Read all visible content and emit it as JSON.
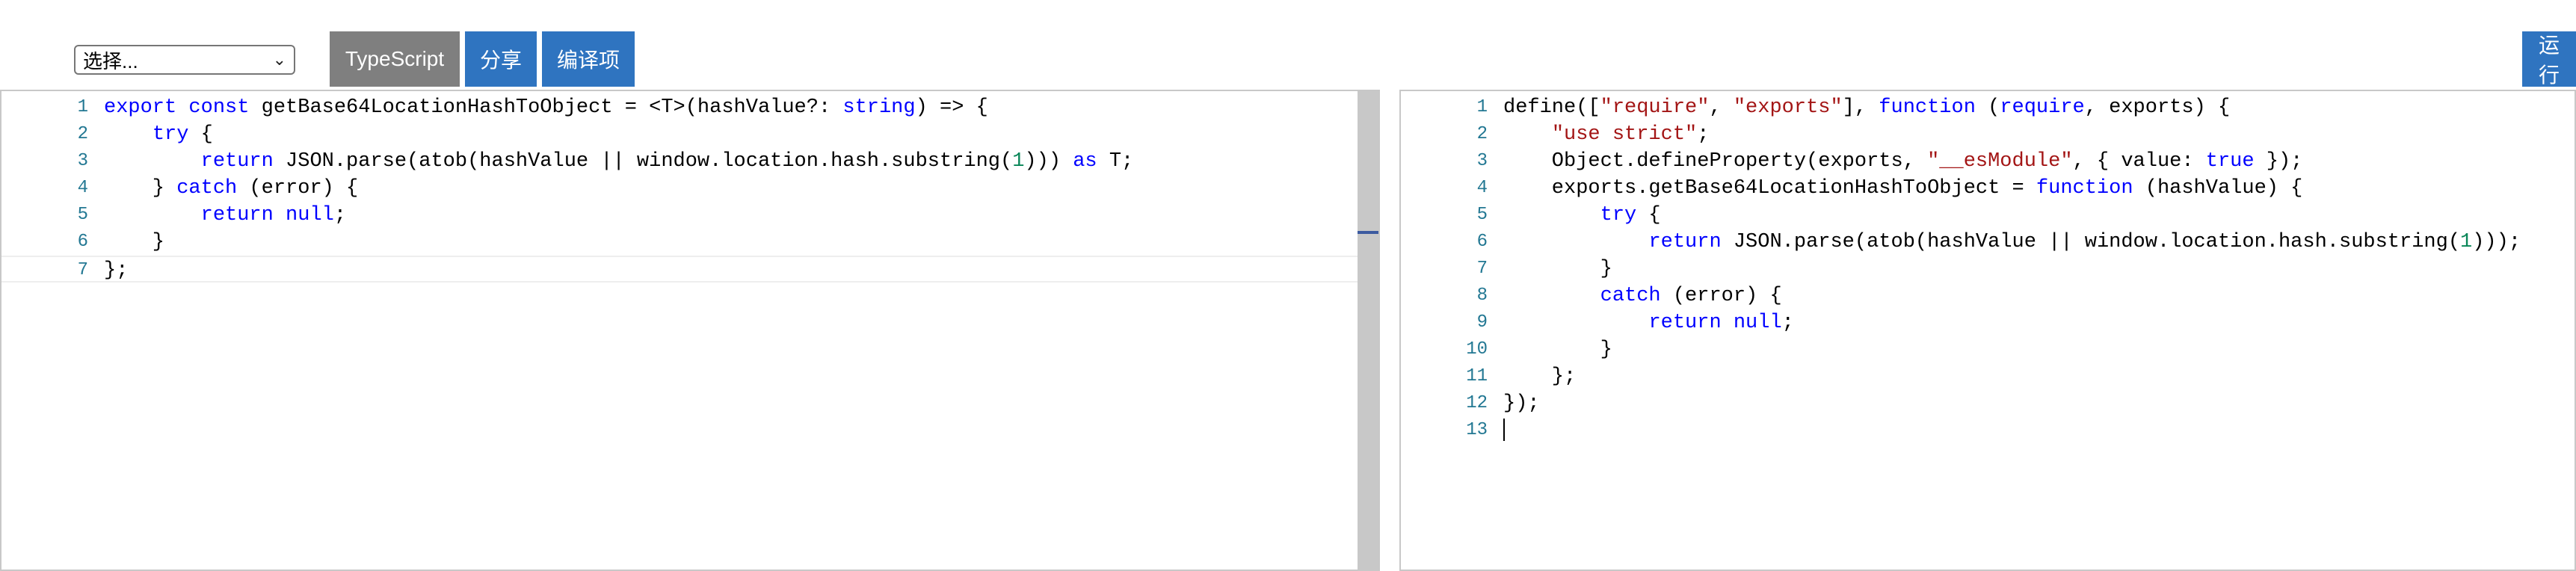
{
  "toolbar": {
    "select_value": "选择...",
    "lang_label": "TypeScript",
    "share_label": "分享",
    "options_label": "编译项",
    "run_label": "运行"
  },
  "left_editor": {
    "lines": [
      {
        "n": "1",
        "tokens": [
          {
            "t": "export",
            "c": "kw"
          },
          {
            "t": " ",
            "c": "id"
          },
          {
            "t": "const",
            "c": "kw"
          },
          {
            "t": " getBase64LocationHashToObject = <T>(hashValue?: ",
            "c": "id"
          },
          {
            "t": "string",
            "c": "kw"
          },
          {
            "t": ") => {",
            "c": "id"
          }
        ]
      },
      {
        "n": "2",
        "tokens": [
          {
            "t": "    ",
            "c": "id"
          },
          {
            "t": "try",
            "c": "kw"
          },
          {
            "t": " {",
            "c": "id"
          }
        ]
      },
      {
        "n": "3",
        "tokens": [
          {
            "t": "        ",
            "c": "id"
          },
          {
            "t": "return",
            "c": "kw"
          },
          {
            "t": " JSON.parse(atob(hashValue || window.location.hash.substring(",
            "c": "id"
          },
          {
            "t": "1",
            "c": "num"
          },
          {
            "t": "))) ",
            "c": "id"
          },
          {
            "t": "as",
            "c": "kw"
          },
          {
            "t": " T;",
            "c": "id"
          }
        ]
      },
      {
        "n": "4",
        "tokens": [
          {
            "t": "    } ",
            "c": "id"
          },
          {
            "t": "catch",
            "c": "kw"
          },
          {
            "t": " (error) {",
            "c": "id"
          }
        ]
      },
      {
        "n": "5",
        "tokens": [
          {
            "t": "        ",
            "c": "id"
          },
          {
            "t": "return",
            "c": "kw"
          },
          {
            "t": " ",
            "c": "id"
          },
          {
            "t": "null",
            "c": "kw"
          },
          {
            "t": ";",
            "c": "id"
          }
        ]
      },
      {
        "n": "6",
        "tokens": [
          {
            "t": "    }",
            "c": "id"
          }
        ]
      },
      {
        "n": "7",
        "tokens": [
          {
            "t": "};",
            "c": "id"
          }
        ]
      }
    ]
  },
  "right_editor": {
    "lines": [
      {
        "n": "1",
        "tokens": [
          {
            "t": "define([",
            "c": "id"
          },
          {
            "t": "\"require\"",
            "c": "str"
          },
          {
            "t": ", ",
            "c": "id"
          },
          {
            "t": "\"exports\"",
            "c": "str"
          },
          {
            "t": "], ",
            "c": "id"
          },
          {
            "t": "function",
            "c": "kw"
          },
          {
            "t": " (",
            "c": "id"
          },
          {
            "t": "require",
            "c": "kw"
          },
          {
            "t": ", exports) {",
            "c": "id"
          }
        ]
      },
      {
        "n": "2",
        "tokens": [
          {
            "t": "    ",
            "c": "id"
          },
          {
            "t": "\"use strict\"",
            "c": "str"
          },
          {
            "t": ";",
            "c": "id"
          }
        ]
      },
      {
        "n": "3",
        "tokens": [
          {
            "t": "    Object.defineProperty(exports, ",
            "c": "id"
          },
          {
            "t": "\"__esModule\"",
            "c": "str"
          },
          {
            "t": ", { value: ",
            "c": "id"
          },
          {
            "t": "true",
            "c": "kw"
          },
          {
            "t": " });",
            "c": "id"
          }
        ]
      },
      {
        "n": "4",
        "tokens": [
          {
            "t": "    exports.getBase64LocationHashToObject = ",
            "c": "id"
          },
          {
            "t": "function",
            "c": "kw"
          },
          {
            "t": " (hashValue) {",
            "c": "id"
          }
        ]
      },
      {
        "n": "5",
        "tokens": [
          {
            "t": "        ",
            "c": "id"
          },
          {
            "t": "try",
            "c": "kw"
          },
          {
            "t": " {",
            "c": "id"
          }
        ]
      },
      {
        "n": "6",
        "tokens": [
          {
            "t": "            ",
            "c": "id"
          },
          {
            "t": "return",
            "c": "kw"
          },
          {
            "t": " JSON.parse(atob(hashValue || window.location.hash.substring(",
            "c": "id"
          },
          {
            "t": "1",
            "c": "num"
          },
          {
            "t": ")));",
            "c": "id"
          }
        ]
      },
      {
        "n": "7",
        "tokens": [
          {
            "t": "        }",
            "c": "id"
          }
        ]
      },
      {
        "n": "8",
        "tokens": [
          {
            "t": "        ",
            "c": "id"
          },
          {
            "t": "catch",
            "c": "kw"
          },
          {
            "t": " (error) {",
            "c": "id"
          }
        ]
      },
      {
        "n": "9",
        "tokens": [
          {
            "t": "            ",
            "c": "id"
          },
          {
            "t": "return",
            "c": "kw"
          },
          {
            "t": " ",
            "c": "id"
          },
          {
            "t": "null",
            "c": "kw"
          },
          {
            "t": ";",
            "c": "id"
          }
        ]
      },
      {
        "n": "10",
        "tokens": [
          {
            "t": "        }",
            "c": "id"
          }
        ]
      },
      {
        "n": "11",
        "tokens": [
          {
            "t": "    };",
            "c": "id"
          }
        ]
      },
      {
        "n": "12",
        "tokens": [
          {
            "t": "});",
            "c": "id"
          }
        ]
      },
      {
        "n": "13",
        "tokens": []
      }
    ]
  },
  "colors": {
    "keyword": "#0000ff",
    "string": "#a31515",
    "number": "#098658",
    "line_number": "#237893",
    "button_blue": "#2f74c0",
    "button_gray": "#7f7f7f"
  }
}
